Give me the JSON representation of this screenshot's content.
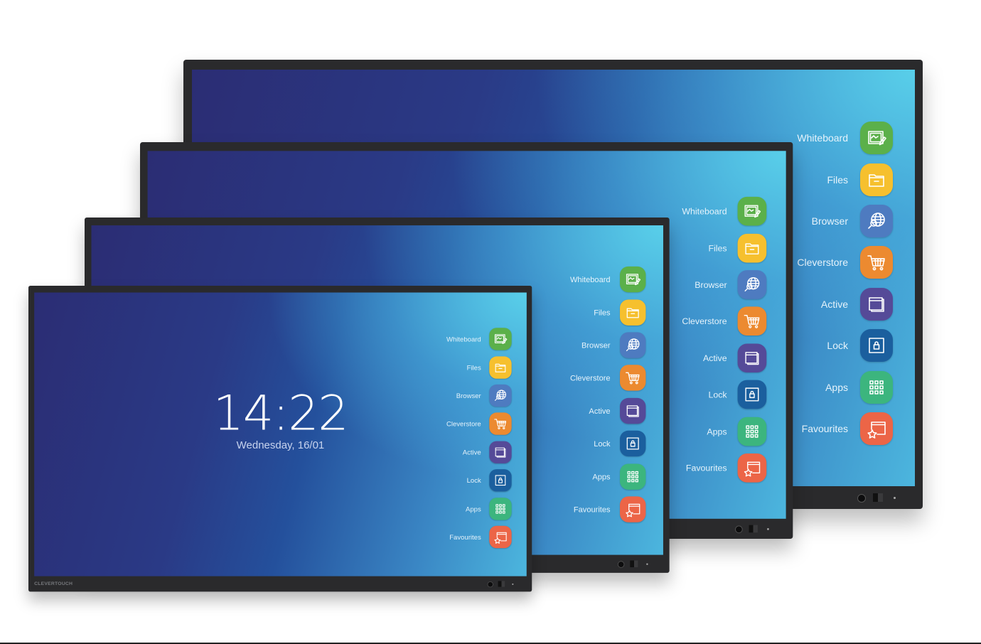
{
  "brand": "CLEVERTOUCH",
  "clock": {
    "time": "14:22",
    "date": "Wednesday, 16/01"
  },
  "menu": [
    {
      "label": "Whiteboard",
      "icon": "whiteboard-icon",
      "color": "#5bb04a"
    },
    {
      "label": "Files",
      "icon": "folder-icon",
      "color": "#f6c02e"
    },
    {
      "label": "Browser",
      "icon": "globe-search-icon",
      "color": "#4e7bc0"
    },
    {
      "label": "Cleverstore",
      "icon": "shopping-cart-icon",
      "color": "#ec8a30"
    },
    {
      "label": "Active",
      "icon": "windows-icon",
      "color": "#554a98"
    },
    {
      "label": "Lock",
      "icon": "lock-icon",
      "color": "#1b5f9e"
    },
    {
      "label": "Apps",
      "icon": "grid-icon",
      "color": "#3cb57e"
    },
    {
      "label": "Favourites",
      "icon": "star-window-icon",
      "color": "#ec6547"
    }
  ],
  "colors": {
    "bezel": "#2a2a2c",
    "screen_dark": "#2b2d74",
    "screen_light": "#4cb6de"
  }
}
